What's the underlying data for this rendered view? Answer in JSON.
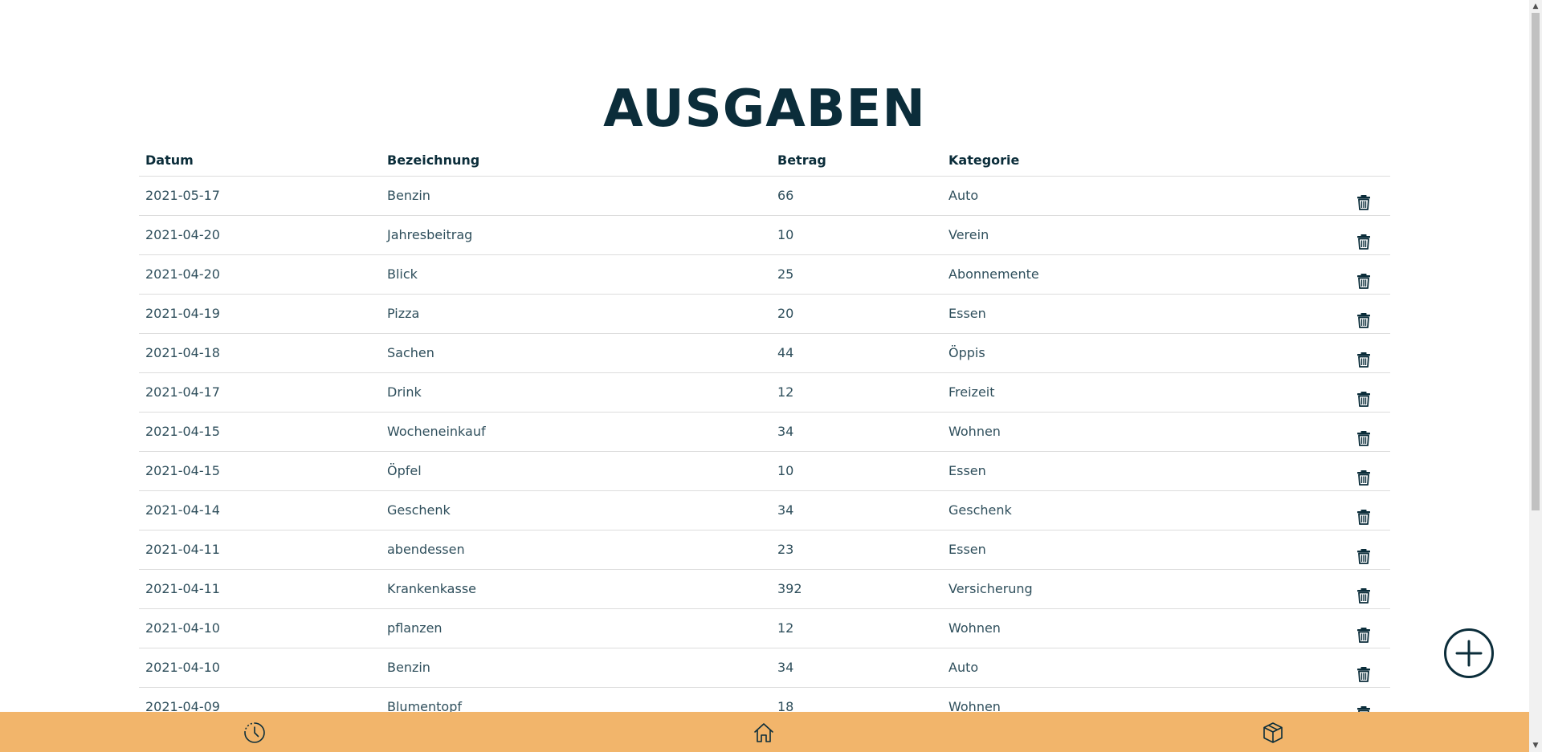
{
  "page": {
    "title": "AUSGABEN"
  },
  "table": {
    "headers": {
      "datum": "Datum",
      "bezeichnung": "Bezeichnung",
      "betrag": "Betrag",
      "kategorie": "Kategorie"
    },
    "rows": [
      {
        "datum": "2021-05-17",
        "bezeichnung": "Benzin",
        "betrag": "66",
        "kategorie": "Auto"
      },
      {
        "datum": "2021-04-20",
        "bezeichnung": "Jahresbeitrag",
        "betrag": "10",
        "kategorie": "Verein"
      },
      {
        "datum": "2021-04-20",
        "bezeichnung": "Blick",
        "betrag": "25",
        "kategorie": "Abonnemente"
      },
      {
        "datum": "2021-04-19",
        "bezeichnung": "Pizza",
        "betrag": "20",
        "kategorie": "Essen"
      },
      {
        "datum": "2021-04-18",
        "bezeichnung": "Sachen",
        "betrag": "44",
        "kategorie": "Öppis"
      },
      {
        "datum": "2021-04-17",
        "bezeichnung": "Drink",
        "betrag": "12",
        "kategorie": "Freizeit"
      },
      {
        "datum": "2021-04-15",
        "bezeichnung": "Wocheneinkauf",
        "betrag": "34",
        "kategorie": "Wohnen"
      },
      {
        "datum": "2021-04-15",
        "bezeichnung": "Öpfel",
        "betrag": "10",
        "kategorie": "Essen"
      },
      {
        "datum": "2021-04-14",
        "bezeichnung": "Geschenk",
        "betrag": "34",
        "kategorie": "Geschenk"
      },
      {
        "datum": "2021-04-11",
        "bezeichnung": "abendessen",
        "betrag": "23",
        "kategorie": "Essen"
      },
      {
        "datum": "2021-04-11",
        "bezeichnung": "Krankenkasse",
        "betrag": "392",
        "kategorie": "Versicherung"
      },
      {
        "datum": "2021-04-10",
        "bezeichnung": "pflanzen",
        "betrag": "12",
        "kategorie": "Wohnen"
      },
      {
        "datum": "2021-04-10",
        "bezeichnung": "Benzin",
        "betrag": "34",
        "kategorie": "Auto"
      },
      {
        "datum": "2021-04-09",
        "bezeichnung": "Blumentopf",
        "betrag": "18",
        "kategorie": "Wohnen"
      }
    ],
    "delete_icon": "trash-icon"
  },
  "fab": {
    "icon": "plus-circle-icon"
  },
  "bottom_nav": {
    "items": [
      {
        "icon": "history-clock-icon"
      },
      {
        "icon": "home-icon"
      },
      {
        "icon": "box-icon"
      }
    ],
    "background": "#f2b56b"
  },
  "colors": {
    "primary": "#0b2d3a",
    "text": "#2f4f5c",
    "nav_bg": "#f2b56b"
  }
}
